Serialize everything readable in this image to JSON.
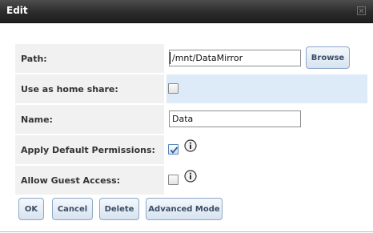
{
  "dialog": {
    "title": "Edit"
  },
  "form": {
    "path": {
      "label": "Path:",
      "value": "/mnt/DataMirror",
      "browse_label": "Browse"
    },
    "home_share": {
      "label": "Use as home share:",
      "checked": false
    },
    "name": {
      "label": "Name:",
      "value": "Data"
    },
    "default_permissions": {
      "label": "Apply Default Permissions:",
      "checked": true
    },
    "guest_access": {
      "label": "Allow Guest Access:",
      "checked": false
    }
  },
  "buttons": {
    "ok": "OK",
    "cancel": "Cancel",
    "delete": "Delete",
    "advanced": "Advanced Mode"
  },
  "colors": {
    "titlebar": "#2b2b2b",
    "highlight_row": "#ddeaf8",
    "button_border": "#8ca7c9"
  }
}
